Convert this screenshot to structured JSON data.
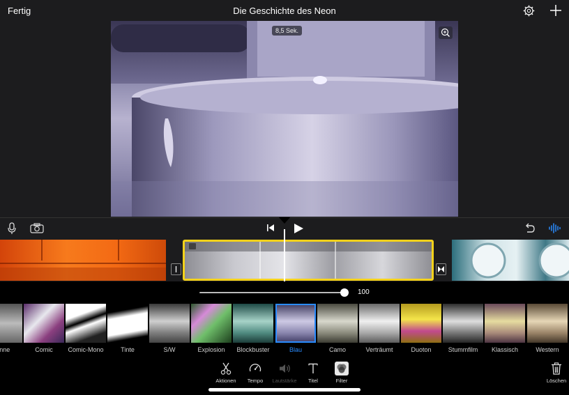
{
  "topbar": {
    "done_label": "Fertig",
    "project_title": "Die Geschichte des Neon"
  },
  "viewer": {
    "duration_badge": "8,5 Sek."
  },
  "intensity": {
    "value": 100,
    "label": "100"
  },
  "filters": [
    {
      "label": "...nne",
      "selected": false
    },
    {
      "label": "Comic",
      "selected": false
    },
    {
      "label": "Comic-Mono",
      "selected": false
    },
    {
      "label": "Tinte",
      "selected": false
    },
    {
      "label": "S/W",
      "selected": false
    },
    {
      "label": "Explosion",
      "selected": false
    },
    {
      "label": "Blockbuster",
      "selected": false
    },
    {
      "label": "Blau",
      "selected": true
    },
    {
      "label": "Camo",
      "selected": false
    },
    {
      "label": "Verträumt",
      "selected": false
    },
    {
      "label": "Duoton",
      "selected": false
    },
    {
      "label": "Stummfilm",
      "selected": false
    },
    {
      "label": "Klassisch",
      "selected": false
    },
    {
      "label": "Western",
      "selected": false
    }
  ],
  "bottom_tools": {
    "actions": "Aktionen",
    "speed": "Tempo",
    "volume": "Lautstärke",
    "titles": "Titel",
    "filters": "Filter",
    "delete": "Löschen"
  },
  "colors": {
    "accent": "#2a8cff",
    "clip_selection": "#f5d21a"
  }
}
